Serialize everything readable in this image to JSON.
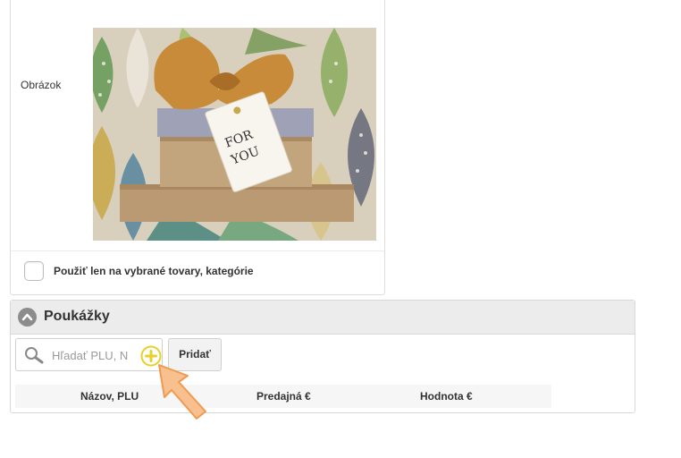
{
  "image_field": {
    "label": "Obrázok"
  },
  "restriction": {
    "label": "Použiť len na vybrané tovary, kategórie",
    "checked": false
  },
  "vouchers": {
    "title": "Poukážky",
    "search_placeholder": "Hľadať PLU, N",
    "add_label": "Pridať",
    "columns": [
      "Názov, PLU",
      "Predajná €",
      "Hodnota €"
    ]
  },
  "icons": {
    "collapse": "chevron-up-icon",
    "search": "search-icon",
    "add": "plus-circle-icon",
    "pointer": "pointer-arrow-icon"
  },
  "colors": {
    "panel_header": "#ececec",
    "plus_yellow": "#e8cf2a",
    "arrow_orange": "#f6a35c"
  }
}
